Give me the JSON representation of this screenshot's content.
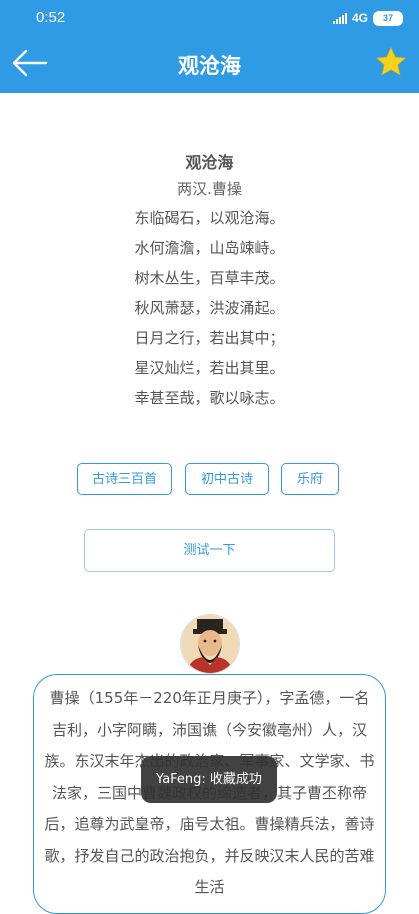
{
  "status_bar": {
    "time": "0:52",
    "network": "4G",
    "battery": "37"
  },
  "header": {
    "title": "观沧海",
    "back_icon": "arrow-left-icon",
    "favorite_icon": "star-icon",
    "bg_color": "#2f9be4",
    "star_color": "#f7d21c"
  },
  "poem": {
    "title": "观沧海",
    "author": "两汉.曹操",
    "lines": [
      "东临碣石，以观沧海。",
      "水何澹澹，山岛竦峙。",
      "树木丛生，百草丰茂。",
      "秋风萧瑟，洪波涌起。",
      "日月之行，若出其中；",
      "星汉灿烂，若出其里。",
      "幸甚至哉，歌以咏志。"
    ]
  },
  "tags": [
    "古诗三百首",
    "初中古诗",
    "乐府"
  ],
  "test_button": "测试一下",
  "bio": {
    "text": "曹操（155年－220年正月庚子），字孟德，一名吉利，小字阿瞒，沛国谯（今安徽亳州）人，汉族。东汉末年杰出的政治家、军事家、文学家、书法家，三国中曹魏政权的缔造者，其子曹丕称帝后，追尊为武皇帝，庙号太祖。曹操精兵法，善诗歌，抒发自己的政治抱负，并反映汉末人民的苦难生活"
  },
  "toast": "YaFeng: 收藏成功"
}
